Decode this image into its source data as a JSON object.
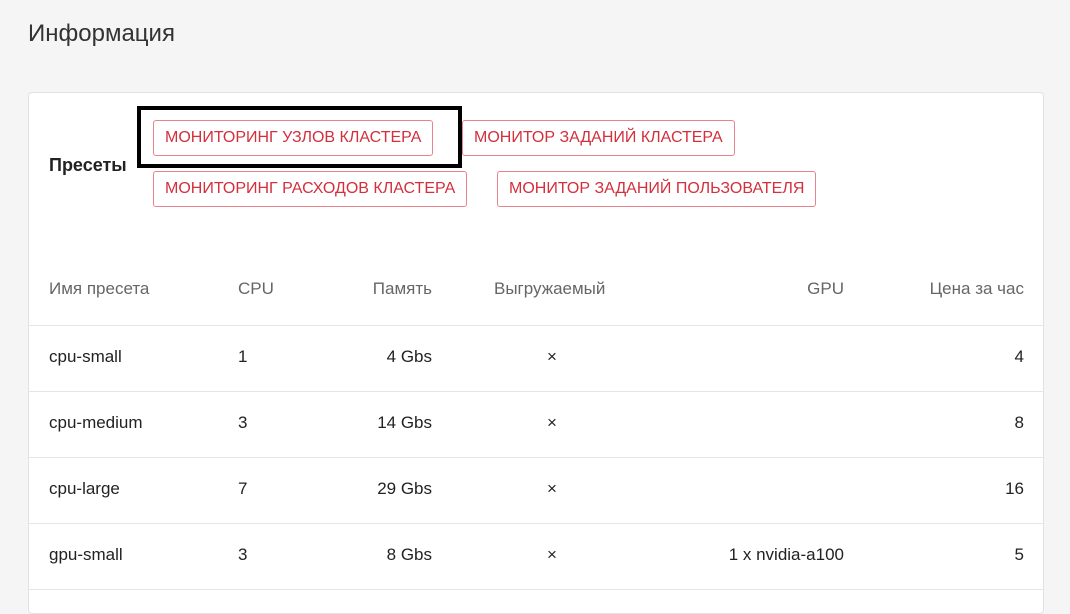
{
  "page": {
    "title": "Информация"
  },
  "presets": {
    "label": "Пресеты",
    "buttons": [
      "МОНИТОРИНГ УЗЛОВ КЛАСТЕРА",
      "МОНИТОР ЗАДАНИЙ КЛАСТЕРА",
      "МОНИТОРИНГ РАСХОДОВ КЛАСТЕРА",
      "МОНИТОР ЗАДАНИЙ ПОЛЬЗОВАТЕЛЯ"
    ]
  },
  "table": {
    "columns": [
      "Имя пресета",
      "CPU",
      "Память",
      "Выгружаемый",
      "GPU",
      "Цена за час"
    ],
    "rows": [
      {
        "name": "cpu-small",
        "cpu": "1",
        "memory": "4 Gbs",
        "preemptible": "×",
        "gpu": "",
        "price": "4"
      },
      {
        "name": "cpu-medium",
        "cpu": "3",
        "memory": "14 Gbs",
        "preemptible": "×",
        "gpu": "",
        "price": "8"
      },
      {
        "name": "cpu-large",
        "cpu": "7",
        "memory": "29 Gbs",
        "preemptible": "×",
        "gpu": "",
        "price": "16"
      },
      {
        "name": "gpu-small",
        "cpu": "3",
        "memory": "8 Gbs",
        "preemptible": "×",
        "gpu": "1 x nvidia-a100",
        "price": "5"
      }
    ]
  },
  "colors": {
    "accent": "#d32f3c",
    "accent_border": "#e8838b",
    "background": "#f5f5f5",
    "card": "#ffffff"
  }
}
